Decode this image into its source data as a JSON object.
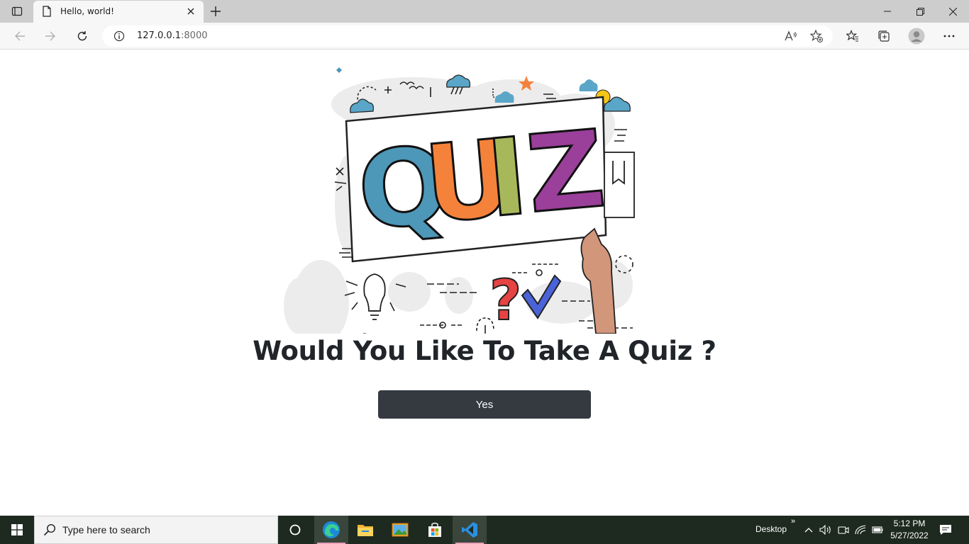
{
  "browser": {
    "tab_title": "Hello, world!",
    "url_host": "127.0.0.1",
    "url_port": ":8000"
  },
  "page": {
    "hero_text": "QUIZ",
    "heading": "Would You Like To Take A Quiz ?",
    "yes_button": "Yes"
  },
  "taskbar": {
    "search_placeholder": "Type here to search",
    "desktop_label": "Desktop",
    "time": "5:12 PM",
    "date": "5/27/2022"
  },
  "colors": {
    "button_bg": "#343a40",
    "heading": "#212529",
    "taskbar_bg": "#1e2a20",
    "quiz_q": "#4d97b8",
    "quiz_u": "#f5823a",
    "quiz_i": "#a7b85a",
    "quiz_z": "#9a3f9a"
  },
  "icons": [
    "tab-actions-icon",
    "page-icon",
    "close-icon",
    "plus-icon",
    "minimize-icon",
    "maximize-icon",
    "back-icon",
    "forward-icon",
    "refresh-icon",
    "info-icon",
    "read-aloud-icon",
    "add-favorite-icon",
    "favorites-icon",
    "collections-icon",
    "profile-icon",
    "more-icon",
    "windows-icon",
    "search-icon",
    "task-view-icon",
    "edge-icon",
    "file-explorer-icon",
    "photos-icon",
    "store-icon",
    "vscode-icon",
    "chevron-up-icon",
    "volume-icon",
    "network-icon",
    "battery-icon",
    "notifications-icon"
  ]
}
